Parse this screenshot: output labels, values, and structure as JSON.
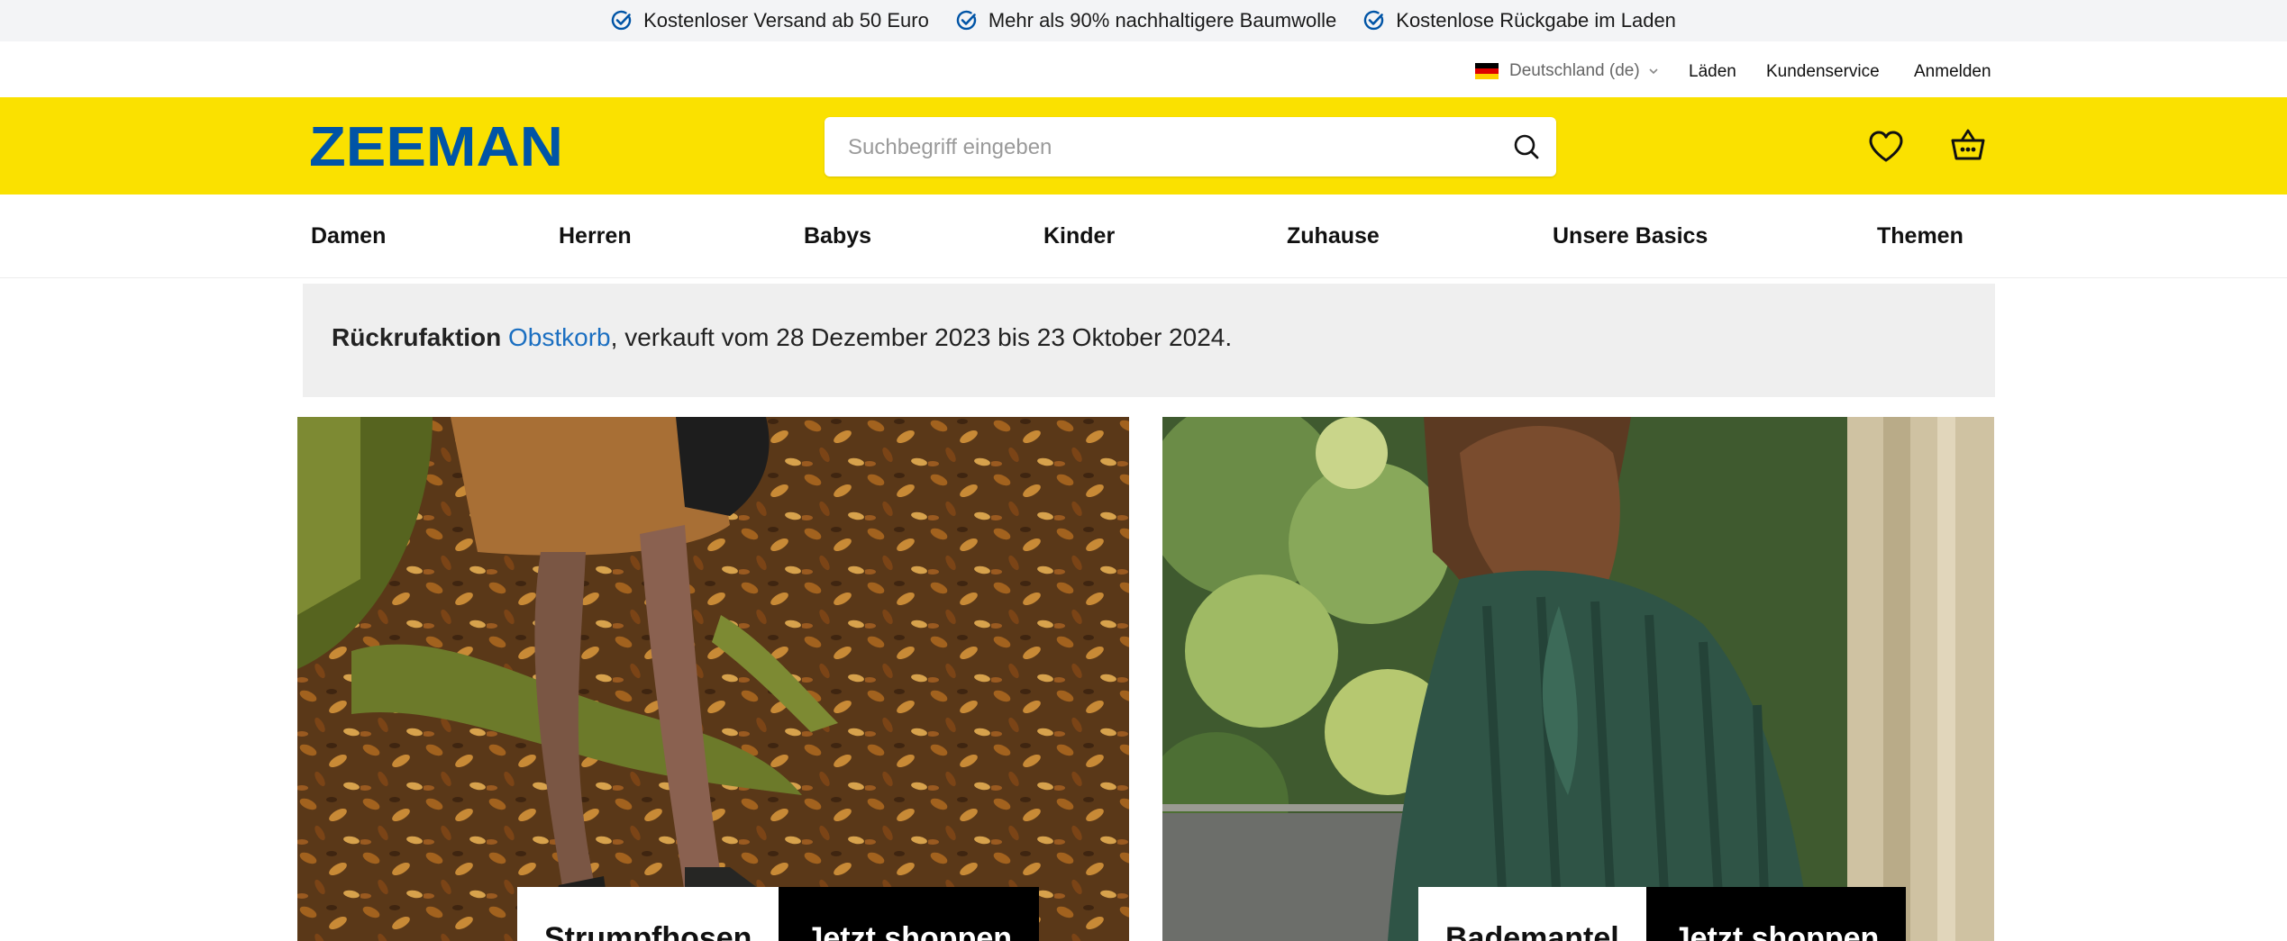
{
  "usp": [
    {
      "icon": "check-circle-icon",
      "text": "Kostenloser Versand ab 50 Euro"
    },
    {
      "icon": "check-circle-icon",
      "text": "Mehr als 90% nachhaltigere Baumwolle"
    },
    {
      "icon": "check-circle-icon",
      "text": "Kostenlose Rückgabe im Laden"
    }
  ],
  "service": {
    "country": "Deutschland (de)",
    "links": [
      "Läden",
      "Kundenservice",
      "Anmelden"
    ]
  },
  "header": {
    "logo": "ZEEMAN",
    "search_placeholder": "Suchbegriff eingeben",
    "icons": [
      "search-icon",
      "heart-icon",
      "basket-icon"
    ]
  },
  "nav": [
    "Damen",
    "Herren",
    "Babys",
    "Kinder",
    "Zuhause",
    "Unsere Basics",
    "Themen"
  ],
  "recall": {
    "title": "Rückrufaktion",
    "link": "Obstkorb",
    "text": ", verkauft vom 28 Dezember 2023 bis 23 Oktober 2024."
  },
  "promos": [
    {
      "label": "Strumpfhosen",
      "button": "Jetzt shoppen"
    },
    {
      "label": "Bademantel",
      "button": "Jetzt shoppen"
    }
  ],
  "colors": {
    "brand_yellow": "#fae100",
    "brand_blue": "#0054a6",
    "link_blue": "#1b6fc1",
    "usp_bar": "#f3f4f6",
    "banner_grey": "#efefef"
  }
}
